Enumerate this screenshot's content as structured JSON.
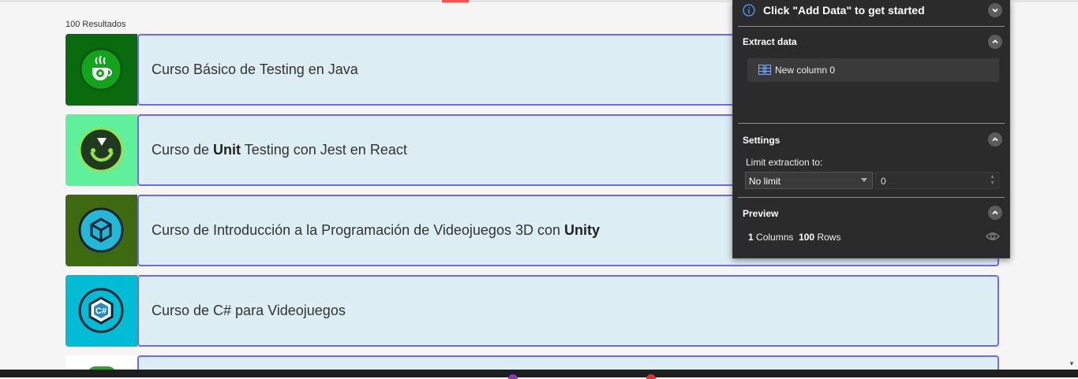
{
  "results": {
    "count_label": "100 Resultados"
  },
  "courses": [
    {
      "thumb_color": "#0a6b0e",
      "icon": "java-cup-gear-icon",
      "title_parts": [
        "Curso Básico de Testing en Java",
        "",
        ""
      ]
    },
    {
      "thumb_color": "#5ef09b",
      "icon": "jest-icon",
      "title_parts": [
        "Curso de ",
        "Unit",
        " Testing con Jest en React"
      ]
    },
    {
      "thumb_color": "#3d6a10",
      "icon": "unity-icon",
      "title_parts": [
        "Curso de Introducción a la Programación de Videojuegos 3D con ",
        "Unity",
        ""
      ]
    },
    {
      "thumb_color": "#00bcd4",
      "icon": "csharp-icon",
      "title_parts": [
        "Curso de C# para Videojuegos",
        "",
        ""
      ]
    }
  ],
  "panel": {
    "header": "Click \"Add Data\" to get started",
    "extract_title": "Extract data",
    "column_label": "New column 0",
    "settings_title": "Settings",
    "limit_label": "Limit extraction to:",
    "limit_option": "No limit",
    "limit_value": "0",
    "preview_title": "Preview",
    "columns_count": "1",
    "columns_word": "Columns",
    "rows_count": "100",
    "rows_word": "Rows"
  },
  "colors": {
    "card_background": "#dcedf4",
    "card_border": "#6a6de3",
    "panel_background": "#2b2b2b",
    "info_blue": "#4a90e2"
  }
}
